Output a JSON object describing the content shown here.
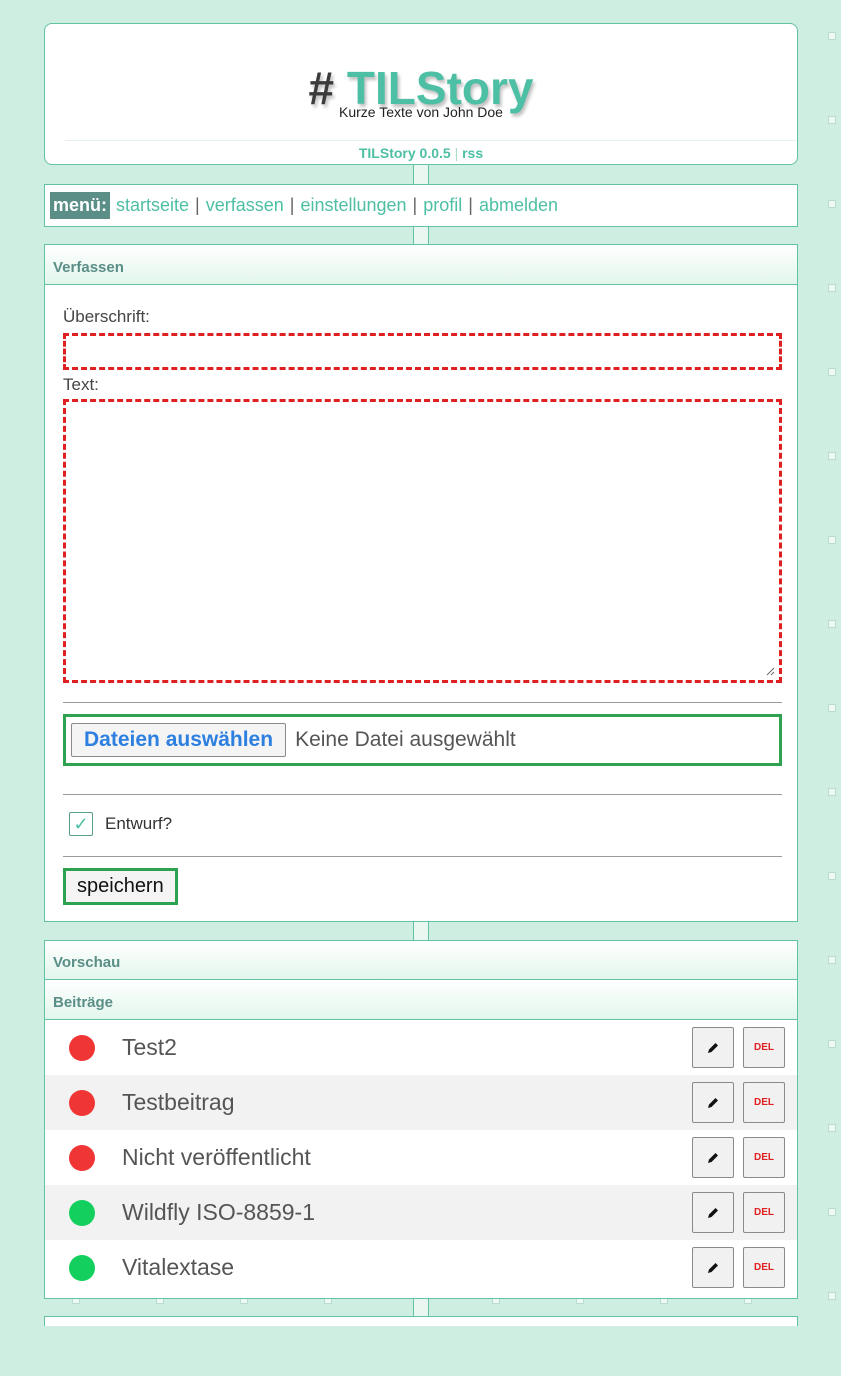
{
  "header": {
    "hash": "#",
    "title": "TILStory",
    "subtitle": "Kurze Texte von John Doe",
    "version": "TILStory 0.0.5",
    "separator": "|",
    "rss": "rss"
  },
  "menu": {
    "label": "menü:",
    "separator": "|",
    "items": [
      {
        "label": "startseite"
      },
      {
        "label": "verfassen"
      },
      {
        "label": "einstellungen"
      },
      {
        "label": "profil"
      },
      {
        "label": "abmelden"
      }
    ]
  },
  "compose": {
    "heading": "Verfassen",
    "title_label": "Überschrift:",
    "title_value": "",
    "text_label": "Text:",
    "text_value": "",
    "file_button": "Dateien auswählen",
    "file_status": "Keine Datei ausgewählt",
    "draft_label": "Entwurf?",
    "draft_checked": true,
    "draft_checkmark": "✓",
    "save_button": "speichern"
  },
  "preview": {
    "heading": "Vorschau"
  },
  "posts": {
    "heading": "Beiträge",
    "delete_label": "DEL",
    "edit_icon": "pencil-icon",
    "status_colors": {
      "unpublished": "#f03535",
      "published": "#13cf5e"
    },
    "items": [
      {
        "title": "Test2",
        "status": "unpublished"
      },
      {
        "title": "Testbeitrag",
        "status": "unpublished"
      },
      {
        "title": "Nicht veröffentlicht",
        "status": "unpublished"
      },
      {
        "title": "Wildfly ISO-8859-1",
        "status": "published"
      },
      {
        "title": "Vitalextase",
        "status": "published"
      }
    ]
  }
}
